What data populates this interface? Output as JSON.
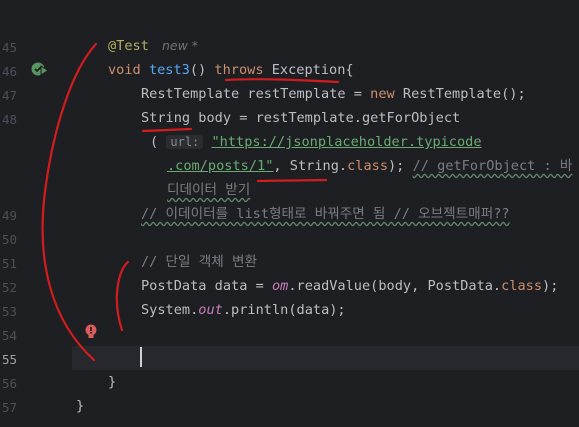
{
  "line_numbers": [
    "45",
    "46",
    "47",
    "48",
    "49",
    "50",
    "51",
    "52",
    "53",
    "54",
    "55",
    "56",
    "57"
  ],
  "current_line": "55",
  "code": {
    "l45_annotation": "@Test",
    "l45_hint": "new *",
    "l46": {
      "kw_void": "void",
      "method": "test3",
      "paren": "() ",
      "kw_throws": "throws",
      "exc": " Exception{"
    },
    "l47": {
      "t1": "RestTemplate restTemplate = ",
      "kw_new": "new",
      "t2": " RestTemplate();"
    },
    "l48": {
      "t1": "String body = restTemplate.getForObject"
    },
    "l48b": {
      "open": "(",
      "hint": "url:",
      "str": "\"https://jsonplaceholder.typicode"
    },
    "l48c": {
      "str": ".com/posts/1\"",
      "t1": ", String.",
      "kw_class": "class",
      "t2": "); ",
      "cmt": "// getForObject : 바"
    },
    "l48d": {
      "cmt": "디데이터 받기"
    },
    "l49": {
      "cmt": "// 이데이터를 list형태로 바꿔주면 됨 // 오브젝트매퍼??"
    },
    "l51": {
      "cmt": "// 단일 객체 변환"
    },
    "l52": {
      "t1": "PostData data = ",
      "field": "om",
      "t2": ".readValue(body, PostData.",
      "kw_class": "class",
      "t3": ");"
    },
    "l53": {
      "t1": "System.",
      "field": "out",
      "t2": ".println(data);"
    },
    "l56": "}",
    "l57": "}"
  },
  "icons": {
    "run": "run-test-icon",
    "bulb": "error-bulb-icon"
  }
}
